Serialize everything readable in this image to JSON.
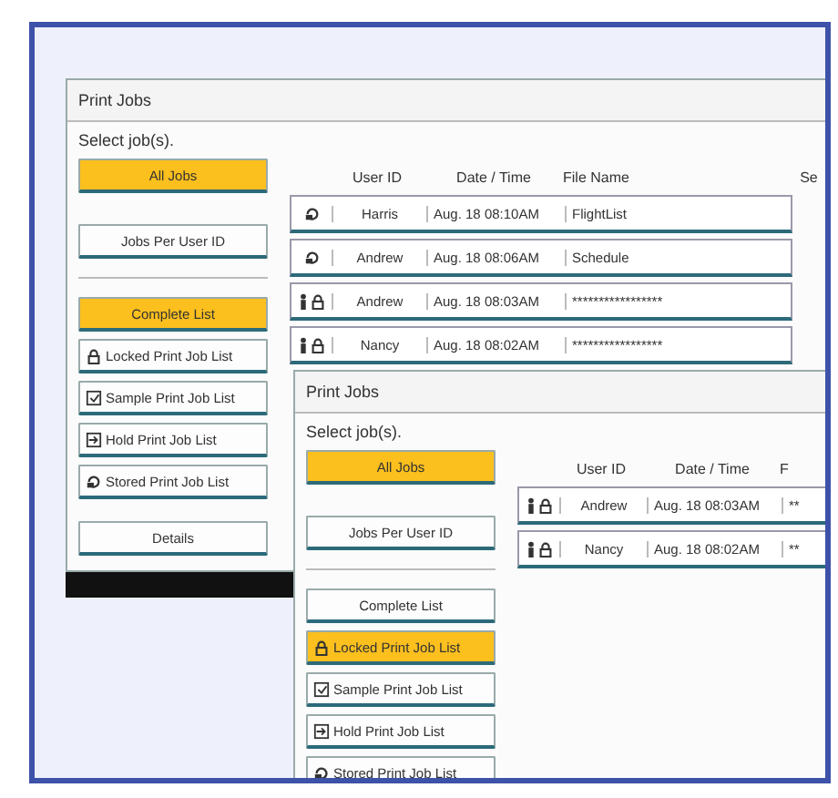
{
  "screens": [
    {
      "title": "Print Jobs",
      "prompt": "Select job(s).",
      "filters": [
        {
          "label": "All Jobs",
          "selected": true
        },
        {
          "label": "Jobs Per User ID",
          "selected": false
        }
      ],
      "lists": [
        {
          "kind": "complete",
          "label": "Complete List",
          "selected": true
        },
        {
          "kind": "locked",
          "label": "Locked Print Job List",
          "selected": false
        },
        {
          "kind": "sample",
          "label": "Sample Print Job List",
          "selected": false
        },
        {
          "kind": "hold",
          "label": "Hold Print Job List",
          "selected": false
        },
        {
          "kind": "stored",
          "label": "Stored Print Job List",
          "selected": false
        }
      ],
      "details_button": "Details",
      "columns": [
        "User ID",
        "Date / Time",
        "File Name",
        "Se"
      ],
      "rows": [
        {
          "kind": "stored",
          "user": "Harris",
          "time": "Aug. 18 08:10AM",
          "file": "FlightList"
        },
        {
          "kind": "stored",
          "user": "Andrew",
          "time": "Aug. 18 08:06AM",
          "file": "Schedule"
        },
        {
          "kind": "locked",
          "user": "Andrew",
          "time": "Aug. 18 08:03AM",
          "file": "*****************"
        },
        {
          "kind": "locked",
          "user": "Nancy",
          "time": "Aug. 18 08:02AM",
          "file": "*****************"
        }
      ]
    },
    {
      "title": "Print Jobs",
      "prompt": "Select job(s).",
      "filters": [
        {
          "label": "All Jobs",
          "selected": true
        },
        {
          "label": "Jobs Per User ID",
          "selected": false
        }
      ],
      "lists": [
        {
          "kind": "complete",
          "label": "Complete List",
          "selected": false
        },
        {
          "kind": "locked",
          "label": "Locked Print Job List",
          "selected": true
        },
        {
          "kind": "sample",
          "label": "Sample Print Job List",
          "selected": false
        },
        {
          "kind": "hold",
          "label": "Hold Print Job List",
          "selected": false
        },
        {
          "kind": "stored",
          "label": "Stored Print Job List",
          "selected": false
        }
      ],
      "columns": [
        "User ID",
        "Date / Time",
        "F"
      ],
      "rows": [
        {
          "kind": "locked",
          "user": "Andrew",
          "time": "Aug. 18 08:03AM",
          "file": "**"
        },
        {
          "kind": "locked",
          "user": "Nancy",
          "time": "Aug. 18 08:02AM",
          "file": "**"
        }
      ]
    }
  ]
}
